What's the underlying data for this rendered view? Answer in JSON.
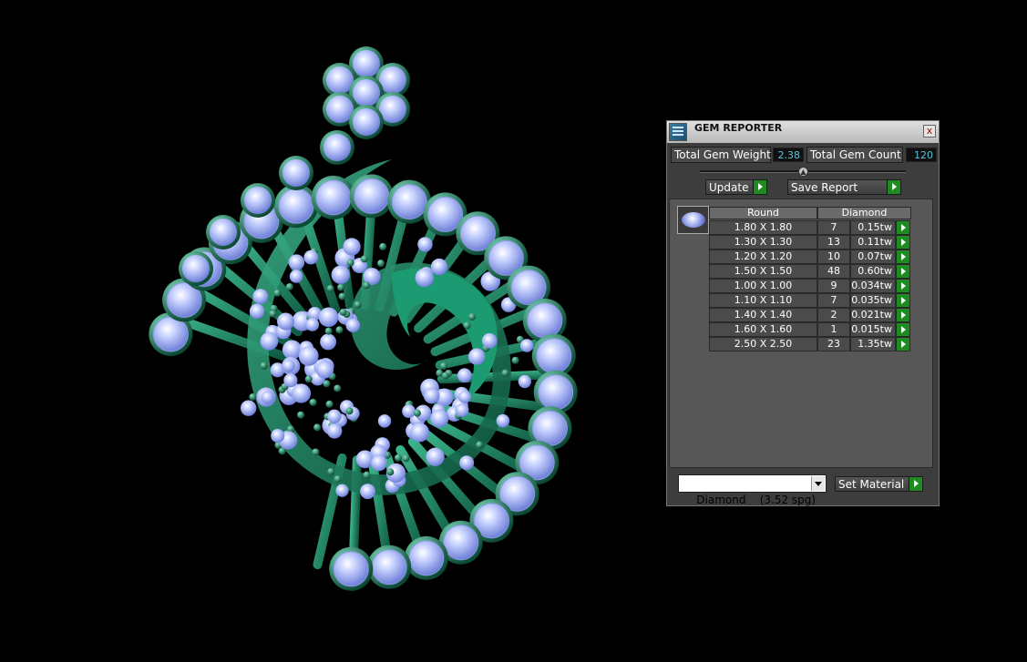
{
  "viewport": {
    "object": "peacock-pendant-render"
  },
  "window": {
    "title": "GEM REPORTER",
    "close_label": "x"
  },
  "stats": {
    "total_weight_label": "Total Gem Weight",
    "total_weight_value": "2.38",
    "total_count_label": "Total Gem Count",
    "total_count_value": "120"
  },
  "buttons": {
    "update": "Update",
    "save_report": "Save Report",
    "set_material": "Set Material"
  },
  "table": {
    "shape_header": "Round",
    "material_header": "Diamond",
    "rows": [
      {
        "size": "1.80 X 1.80",
        "count": "7",
        "weight": "0.15tw"
      },
      {
        "size": "1.30 X 1.30",
        "count": "13",
        "weight": "0.11tw"
      },
      {
        "size": "1.20 X 1.20",
        "count": "10",
        "weight": "0.07tw"
      },
      {
        "size": "1.50 X 1.50",
        "count": "48",
        "weight": "0.60tw"
      },
      {
        "size": "1.00 X 1.00",
        "count": "9",
        "weight": "0.034tw"
      },
      {
        "size": "1.10 X 1.10",
        "count": "7",
        "weight": "0.035tw"
      },
      {
        "size": "1.40 X 1.40",
        "count": "2",
        "weight": "0.021tw"
      },
      {
        "size": "1.60 X 1.60",
        "count": "1",
        "weight": "0.015tw"
      },
      {
        "size": "2.50 X 2.50",
        "count": "23",
        "weight": "1.35tw"
      }
    ]
  },
  "material_select": {
    "value": "Diamond    (3.52 spg)"
  },
  "colors": {
    "metal": "#1f7a5e",
    "gem": "#a9b8f5",
    "arrow_green": "#1f8a1f",
    "value_text": "#5bc2d8"
  }
}
